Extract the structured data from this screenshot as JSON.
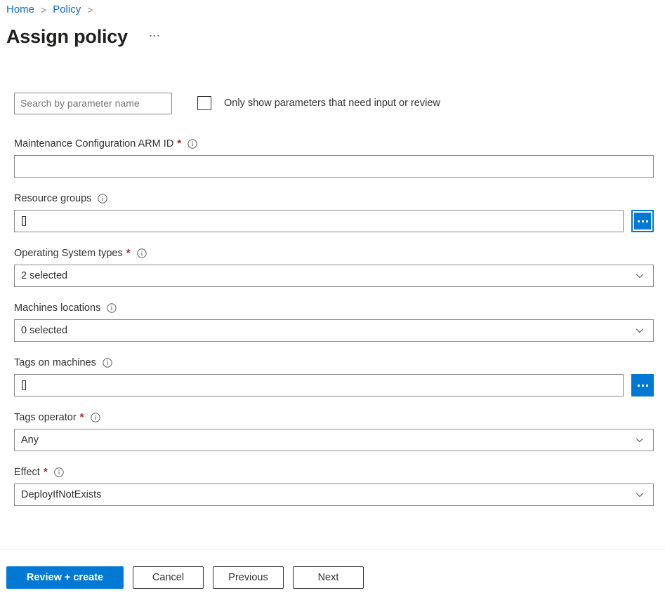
{
  "breadcrumb": {
    "items": [
      {
        "label": "Home",
        "separator": ">"
      },
      {
        "label": "Policy",
        "separator": ">"
      }
    ]
  },
  "header": {
    "title": "Assign policy",
    "more_label": "⋯",
    "more_icon": "ellipsis-icon"
  },
  "filter": {
    "search_placeholder": "Search by parameter name",
    "search_value": "",
    "checkbox_label": "Only show parameters that need input or review",
    "checkbox_checked": false
  },
  "form": {
    "fields": [
      {
        "label": "Maintenance Configuration ARM ID",
        "required": true,
        "star": "*",
        "info_icon": "info-icon",
        "control": "text",
        "value": "",
        "placeholder": "",
        "picker": false
      },
      {
        "label": "Resource groups",
        "required": false,
        "star": "",
        "info_icon": "info-icon",
        "control": "text",
        "value": "[]",
        "placeholder": "",
        "picker": true,
        "picker_focused": true,
        "picker_icon": "ellipsis-icon"
      },
      {
        "label": "Operating System types",
        "required": true,
        "star": "*",
        "info_icon": "info-icon",
        "control": "select",
        "value": "2 selected",
        "chevron_icon": "chevron-down-icon"
      },
      {
        "label": "Machines locations",
        "required": false,
        "star": "",
        "info_icon": "info-icon",
        "control": "select",
        "value": "0 selected",
        "chevron_icon": "chevron-down-icon"
      },
      {
        "label": "Tags on machines",
        "required": false,
        "star": "",
        "info_icon": "info-icon",
        "control": "text",
        "value": "[]",
        "placeholder": "",
        "picker": true,
        "picker_focused": false,
        "picker_icon": "ellipsis-icon"
      },
      {
        "label": "Tags operator",
        "required": true,
        "star": "*",
        "info_icon": "info-icon",
        "control": "select",
        "value": "Any",
        "chevron_icon": "chevron-down-icon"
      },
      {
        "label": "Effect",
        "required": true,
        "star": "*",
        "info_icon": "info-icon",
        "control": "select",
        "value": "DeployIfNotExists",
        "chevron_icon": "chevron-down-icon"
      }
    ]
  },
  "footer": {
    "buttons": [
      {
        "label": "Review + create",
        "style": "primary"
      },
      {
        "label": "Cancel",
        "style": "default"
      },
      {
        "label": "Previous",
        "style": "default"
      },
      {
        "label": "Next",
        "style": "default"
      }
    ]
  },
  "colors": {
    "accent": "#0078d4",
    "link": "#0f6cbd",
    "required_star": "#a4262c",
    "text": "#323130",
    "border": "#8a8886",
    "divider": "#edebe9"
  }
}
